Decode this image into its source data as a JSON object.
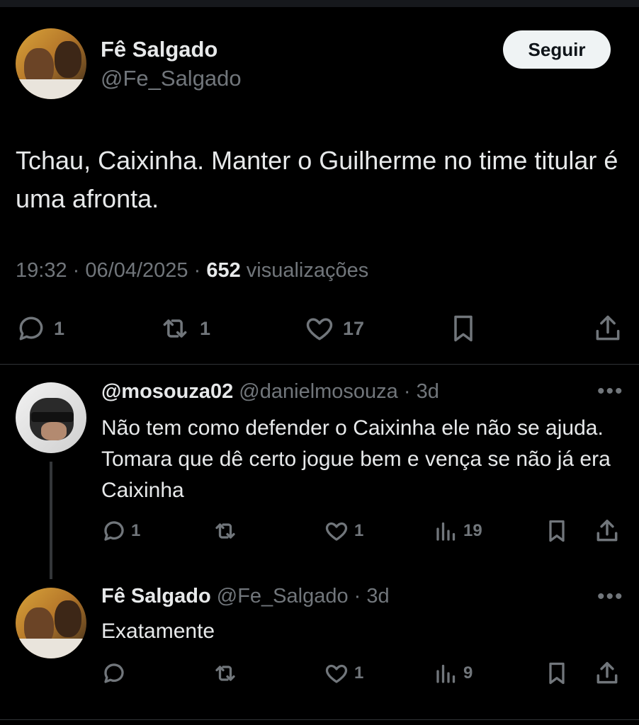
{
  "tweet": {
    "name": "Fê Salgado",
    "handle": "@Fe_Salgado",
    "follow_label": "Seguir",
    "text": "Tchau, Caixinha. Manter o Guilherme no time titular é uma afronta.",
    "time": "19:32",
    "date": "06/04/2025",
    "views_count": "652",
    "views_label": "visualizações",
    "replies": "1",
    "reposts": "1",
    "likes": "17"
  },
  "replies": [
    {
      "name": "@mosouza02",
      "handle": "@danielmosouza",
      "age": "3d",
      "text": "Não tem como defender o Caixinha ele não se ajuda. Tomara que dê certo jogue bem e vença se não já era Caixinha",
      "replies": "1",
      "reposts": "",
      "likes": "1",
      "views": "19"
    },
    {
      "name": "Fê Salgado",
      "handle": "@Fe_Salgado",
      "age": "3d",
      "text": "Exatamente",
      "replies": "",
      "reposts": "",
      "likes": "1",
      "views": "9"
    }
  ],
  "separator": "·",
  "icons": [
    "reply-icon",
    "repost-icon",
    "like-icon",
    "bookmark-icon",
    "share-icon",
    "views-icon",
    "more-icon"
  ]
}
